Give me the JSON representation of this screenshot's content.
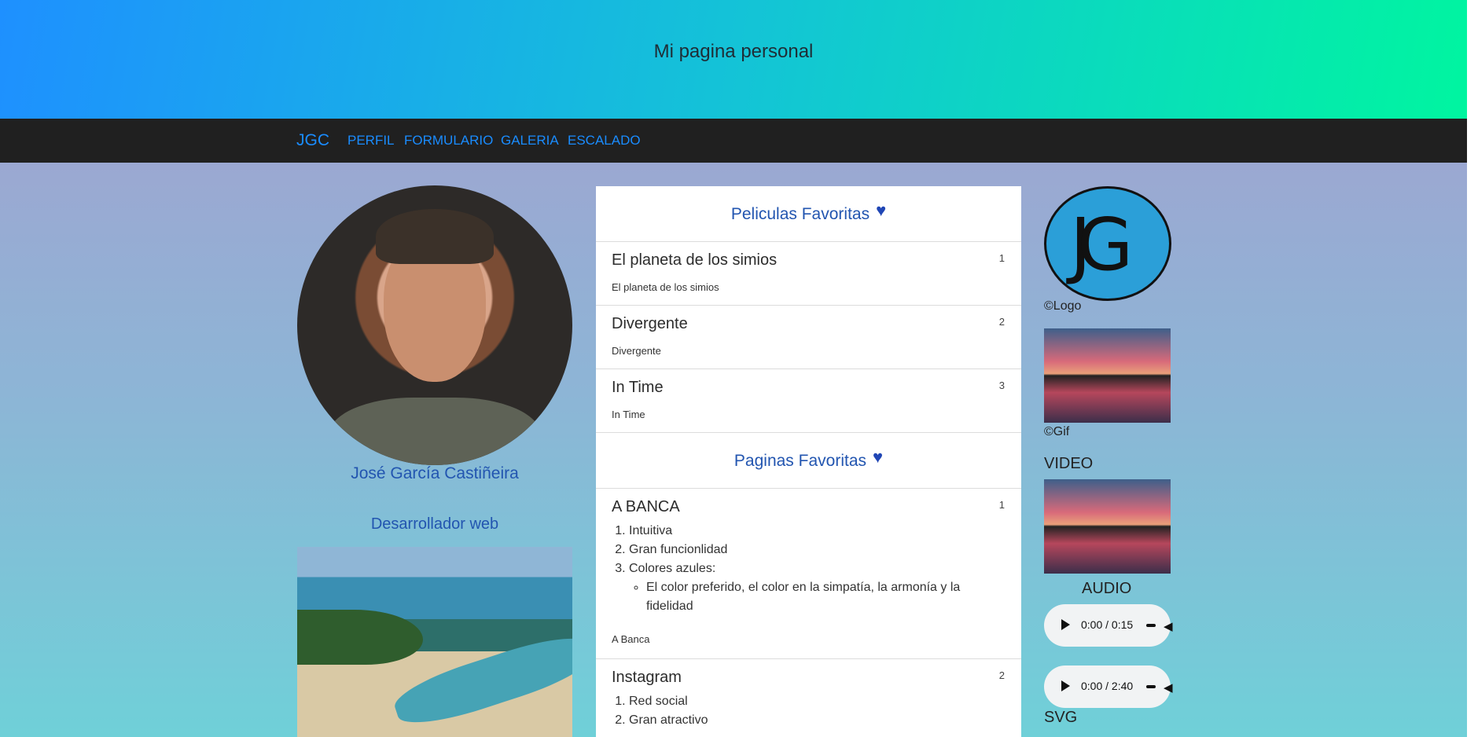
{
  "header": {
    "title": "Mi pagina personal"
  },
  "nav": {
    "brand": "JGC",
    "links": [
      "PERFIL",
      "FORMULARIO",
      "GALERIA",
      "ESCALADO"
    ]
  },
  "profile": {
    "name": "José García Castiñeira",
    "role": "Desarrollador web"
  },
  "movies": {
    "title": "Peliculas Favoritas",
    "items": [
      {
        "title": "El planeta de los simios",
        "num": "1",
        "sub": "El planeta de los simios"
      },
      {
        "title": "Divergente",
        "num": "2",
        "sub": "Divergente"
      },
      {
        "title": "In Time",
        "num": "3",
        "sub": "In Time"
      }
    ]
  },
  "pages": {
    "title": "Paginas Favoritas",
    "items": [
      {
        "title": "A BANCA",
        "num": "1",
        "points": [
          "Intuitiva",
          "Gran funcionlidad",
          "Colores azules:"
        ],
        "subpoint": "El color preferido, el color en la simpatía, la armonía y la fidelidad",
        "sub": "A Banca"
      },
      {
        "title": "Instagram",
        "num": "2",
        "points": [
          "Red social",
          "Gran atractivo"
        ]
      }
    ]
  },
  "sidebar": {
    "logo_caption": "©Logo",
    "gif_caption": "©Gif",
    "video_label": "VIDEO",
    "audio_label": "AUDIO",
    "audio1_time": "0:00 / 0:15",
    "audio2_time": "0:00 / 2:40",
    "svg_label": "SVG"
  }
}
